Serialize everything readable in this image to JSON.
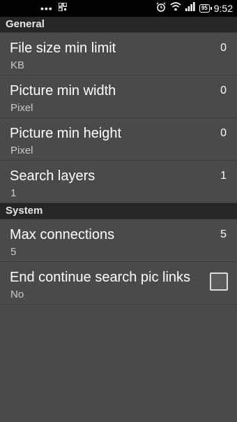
{
  "statusbar": {
    "dots": "•••",
    "battery": "95",
    "time": "9:52",
    "icons": [
      "qr-icon",
      "alarm-icon",
      "wifi-icon",
      "signal-icon",
      "battery-icon"
    ]
  },
  "sections": {
    "general": {
      "header": "General",
      "items": [
        {
          "title": "File size min limit",
          "summary": "KB",
          "value": "0"
        },
        {
          "title": "Picture min width",
          "summary": "Pixel",
          "value": "0"
        },
        {
          "title": "Picture min height",
          "summary": "Pixel",
          "value": "0"
        },
        {
          "title": "Search layers",
          "summary": "1",
          "value": "1"
        }
      ]
    },
    "system": {
      "header": "System",
      "items": [
        {
          "title": "Max connections",
          "summary": "5",
          "value": "5"
        },
        {
          "title": "End continue search pic links",
          "summary": "No",
          "checked": false
        }
      ]
    }
  }
}
